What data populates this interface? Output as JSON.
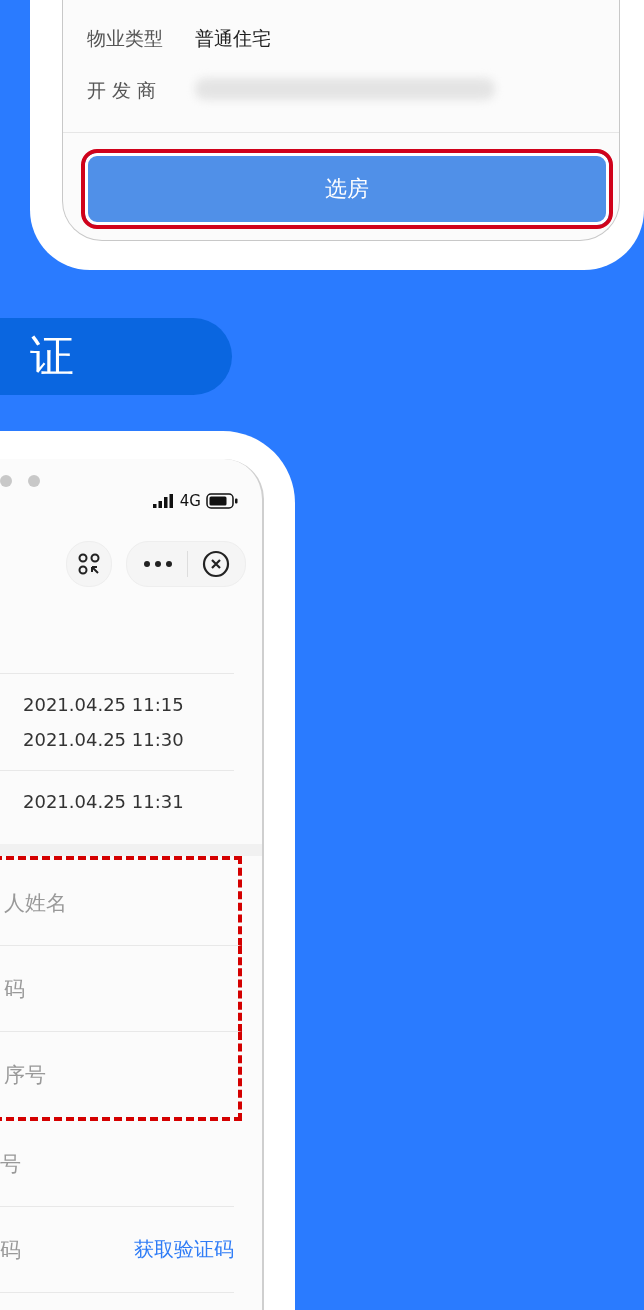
{
  "top_phone": {
    "info_rows": [
      {
        "label": "物业类型",
        "value": "普通住宅"
      },
      {
        "label": "开 发 商",
        "value": ""
      }
    ],
    "primary_button": "选房"
  },
  "section_banner": {
    "title": "证"
  },
  "bottom_phone": {
    "status_bar": {
      "network": "4G"
    },
    "time_rows": [
      {
        "values": [
          "2021.04.25 11:15",
          "2021.04.25 11:30"
        ]
      },
      {
        "values": [
          "2021.04.25 11:31"
        ]
      }
    ],
    "form_fields": [
      {
        "placeholder": "人姓名",
        "highlighted": true
      },
      {
        "placeholder": "码",
        "highlighted": true
      },
      {
        "placeholder": "序号",
        "highlighted": true
      },
      {
        "placeholder": "号",
        "highlighted": false
      },
      {
        "placeholder": "码",
        "highlighted": false,
        "action": "获取验证码"
      }
    ]
  }
}
